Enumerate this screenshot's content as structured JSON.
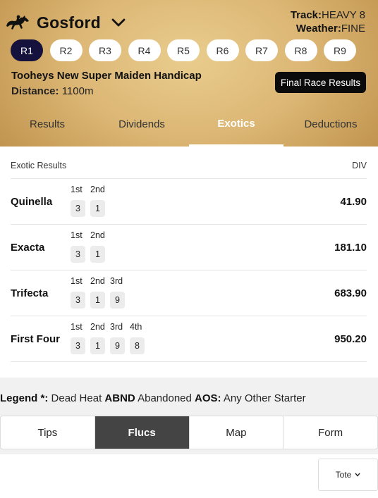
{
  "venue": {
    "name": "Gosford",
    "icon": "horse-jockey-icon"
  },
  "track": {
    "track_label": "Track:",
    "track_value": "HEAVY 8",
    "weather_label": "Weather:",
    "weather_value": "FINE"
  },
  "races": [
    {
      "label": "R1",
      "active": true
    },
    {
      "label": "R2"
    },
    {
      "label": "R3"
    },
    {
      "label": "R4"
    },
    {
      "label": "R5"
    },
    {
      "label": "R6"
    },
    {
      "label": "R7"
    },
    {
      "label": "R8"
    },
    {
      "label": "R9"
    }
  ],
  "race": {
    "name": "Tooheys New Super Maiden Handicap",
    "distance_label": "Distance:",
    "distance_value": "1100m"
  },
  "final_results_button": "Final Race Results",
  "tabs": [
    {
      "label": "Results"
    },
    {
      "label": "Dividends"
    },
    {
      "label": "Exotics",
      "active": true
    },
    {
      "label": "Deductions"
    }
  ],
  "exotics": {
    "header_left": "Exotic Results",
    "header_right": "DIV",
    "rows": [
      {
        "type": "Quinella",
        "positions": [
          "1st",
          "2nd"
        ],
        "runners": [
          "3",
          "1"
        ],
        "div": "41.90"
      },
      {
        "type": "Exacta",
        "positions": [
          "1st",
          "2nd"
        ],
        "runners": [
          "3",
          "1"
        ],
        "div": "181.10"
      },
      {
        "type": "Trifecta",
        "positions": [
          "1st",
          "2nd",
          "3rd"
        ],
        "runners": [
          "3",
          "1",
          "9"
        ],
        "div": "683.90"
      },
      {
        "type": "First Four",
        "positions": [
          "1st",
          "2nd",
          "3rd",
          "4th"
        ],
        "runners": [
          "3",
          "1",
          "9",
          "8"
        ],
        "div": "950.20"
      }
    ]
  },
  "legend": {
    "title": "Legend",
    "dh_key": "*:",
    "dh_text": "Dead Heat",
    "abnd_key": "ABND",
    "abnd_text": "Abandoned",
    "aos_key": "AOS:",
    "aos_text": "Any Other Starter"
  },
  "bottom_tabs": [
    {
      "label": "Tips"
    },
    {
      "label": "Flucs",
      "active": true
    },
    {
      "label": "Map"
    },
    {
      "label": "Form"
    }
  ],
  "tote_select": {
    "label": "Tote",
    "icon": "chevron-down-icon"
  },
  "colors": {
    "accent_dark": "#15123d",
    "gold": "#dcb674",
    "active_tab_bg": "#444444"
  }
}
